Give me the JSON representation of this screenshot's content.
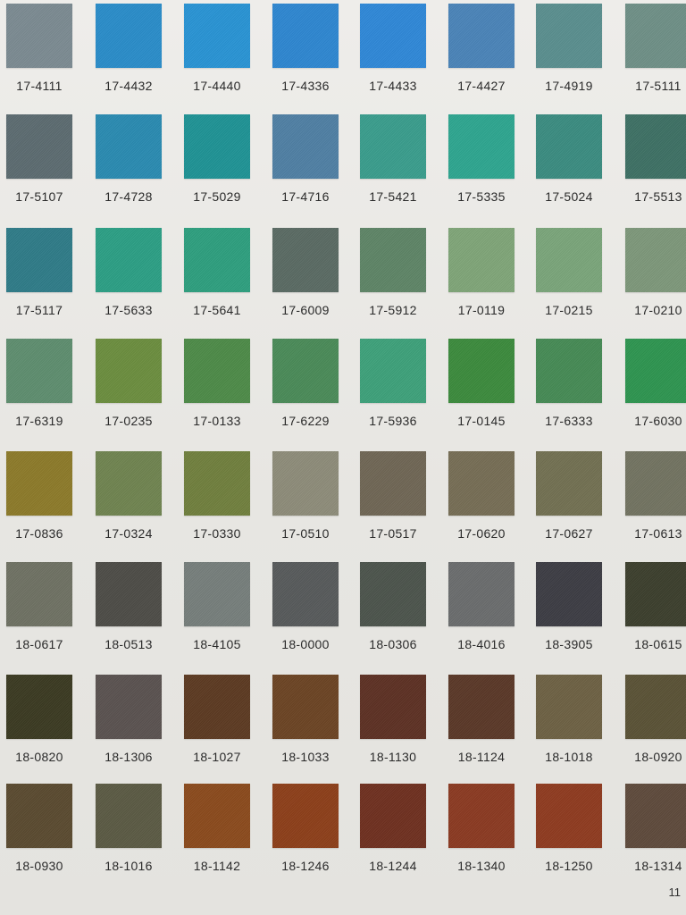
{
  "rows": [
    [
      {
        "code": "17-4111",
        "color": "#7b8a91"
      },
      {
        "code": "17-4432",
        "color": "#2a8cc8"
      },
      {
        "code": "17-4440",
        "color": "#2993d3"
      },
      {
        "code": "17-4336",
        "color": "#2e86cf"
      },
      {
        "code": "17-4433",
        "color": "#2f87d6"
      },
      {
        "code": "17-4427",
        "color": "#4a83b7"
      },
      {
        "code": "17-4919",
        "color": "#5a8e8e"
      },
      {
        "code": "17-5111",
        "color": "#6e8f86"
      }
    ],
    [
      {
        "code": "17-5107",
        "color": "#5c6b70"
      },
      {
        "code": "17-4728",
        "color": "#2a8ab0"
      },
      {
        "code": "17-5029",
        "color": "#1f9294"
      },
      {
        "code": "17-4716",
        "color": "#4f7fa3"
      },
      {
        "code": "17-5421",
        "color": "#3a9c8c"
      },
      {
        "code": "17-5335",
        "color": "#2ea58f"
      },
      {
        "code": "17-5024",
        "color": "#3b8b80"
      },
      {
        "code": "17-5513",
        "color": "#3e7064"
      }
    ],
    [
      {
        "code": "17-5117",
        "color": "#2f7b87"
      },
      {
        "code": "17-5633",
        "color": "#2c9e84"
      },
      {
        "code": "17-5641",
        "color": "#2e9e7e"
      },
      {
        "code": "17-6009",
        "color": "#5a6a63"
      },
      {
        "code": "17-5912",
        "color": "#5e8466"
      },
      {
        "code": "17-0119",
        "color": "#7fa478"
      },
      {
        "code": "17-0215",
        "color": "#7aa47a"
      },
      {
        "code": "17-0210",
        "color": "#7d977a"
      }
    ],
    [
      {
        "code": "17-6319",
        "color": "#5e8d6e"
      },
      {
        "code": "17-0235",
        "color": "#6b8d3f"
      },
      {
        "code": "17-0133",
        "color": "#4d8a48"
      },
      {
        "code": "17-6229",
        "color": "#4a8a58"
      },
      {
        "code": "17-5936",
        "color": "#3ea07a"
      },
      {
        "code": "17-0145",
        "color": "#3c8a3d"
      },
      {
        "code": "17-6333",
        "color": "#468a55"
      },
      {
        "code": "17-6030",
        "color": "#2e9450"
      }
    ],
    [
      {
        "code": "17-0836",
        "color": "#8c7a2a"
      },
      {
        "code": "17-0324",
        "color": "#6f8350"
      },
      {
        "code": "17-0330",
        "color": "#707f3e"
      },
      {
        "code": "17-0510",
        "color": "#8d8b79"
      },
      {
        "code": "17-0517",
        "color": "#6f6655"
      },
      {
        "code": "17-0620",
        "color": "#766d55"
      },
      {
        "code": "17-0627",
        "color": "#727052"
      },
      {
        "code": "17-0613",
        "color": "#727361"
      }
    ],
    [
      {
        "code": "18-0617",
        "color": "#6e7163"
      },
      {
        "code": "18-0513",
        "color": "#4d4c47"
      },
      {
        "code": "18-4105",
        "color": "#767e7b"
      },
      {
        "code": "18-0000",
        "color": "#575a5b"
      },
      {
        "code": "18-0306",
        "color": "#4c544c"
      },
      {
        "code": "18-4016",
        "color": "#6a6c6d"
      },
      {
        "code": "18-3905",
        "color": "#3d3d44"
      },
      {
        "code": "18-0615",
        "color": "#3c3f2d"
      }
    ],
    [
      {
        "code": "18-0820",
        "color": "#3b3a22"
      },
      {
        "code": "18-1306",
        "color": "#5a5250"
      },
      {
        "code": "18-1027",
        "color": "#5c3a22"
      },
      {
        "code": "18-1033",
        "color": "#6b4424"
      },
      {
        "code": "18-1130",
        "color": "#5d3124"
      },
      {
        "code": "18-1124",
        "color": "#5a3828"
      },
      {
        "code": "18-1018",
        "color": "#6d6144"
      },
      {
        "code": "18-0920",
        "color": "#5a5236"
      }
    ],
    [
      {
        "code": "18-0930",
        "color": "#5a4a30"
      },
      {
        "code": "18-1016",
        "color": "#5b5a44"
      },
      {
        "code": "18-1142",
        "color": "#8a4a1d"
      },
      {
        "code": "18-1246",
        "color": "#8c3f1a"
      },
      {
        "code": "18-1244",
        "color": "#6e3020"
      },
      {
        "code": "18-1340",
        "color": "#8a3a22"
      },
      {
        "code": "18-1250",
        "color": "#8e3b20"
      },
      {
        "code": "18-1314",
        "color": "#5e4a3c"
      }
    ]
  ],
  "page_number": "11"
}
